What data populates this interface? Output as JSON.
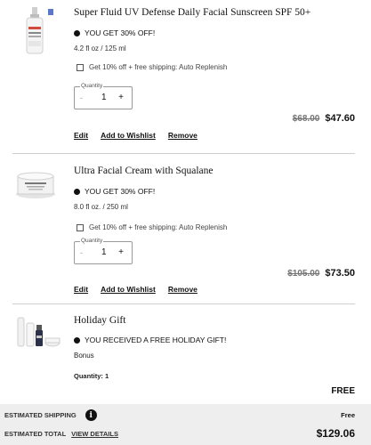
{
  "items": [
    {
      "title": "Super Fluid UV Defense Daily Facial Sunscreen SPF 50+",
      "promo": "YOU GET 30% OFF!",
      "size": "4.2 fl oz / 125 ml",
      "replenish": "Get 10% off + free shipping: Auto Replenish",
      "quantity_label": "Quantity",
      "quantity": "1",
      "old_price": "$68.00",
      "new_price": "$47.60",
      "actions": {
        "edit": "Edit",
        "wishlist": "Add to Wishlist",
        "remove": "Remove"
      }
    },
    {
      "title": "Ultra Facial Cream with Squalane",
      "promo": "YOU GET 30% OFF!",
      "size": "8.0 fl oz. / 250 ml",
      "replenish": "Get 10% off + free shipping: Auto Replenish",
      "quantity_label": "Quantity",
      "quantity": "1",
      "old_price": "$105.00",
      "new_price": "$73.50",
      "actions": {
        "edit": "Edit",
        "wishlist": "Add to Wishlist",
        "remove": "Remove"
      }
    },
    {
      "title": "Holiday Gift",
      "promo": "YOU RECEIVED A FREE HOLIDAY GIFT!",
      "bonus": "Bonus",
      "quantity_text": "Quantity: 1",
      "price": "FREE"
    }
  ],
  "qty_symbols": {
    "minus": "-",
    "plus": "+"
  },
  "summary": {
    "shipping_label": "ESTIMATED SHIPPING",
    "shipping_info_icon": "i",
    "shipping_value": "Free",
    "total_label": "ESTIMATED TOTAL",
    "view_details": "VIEW DETAILS",
    "total_value": "$129.06"
  }
}
